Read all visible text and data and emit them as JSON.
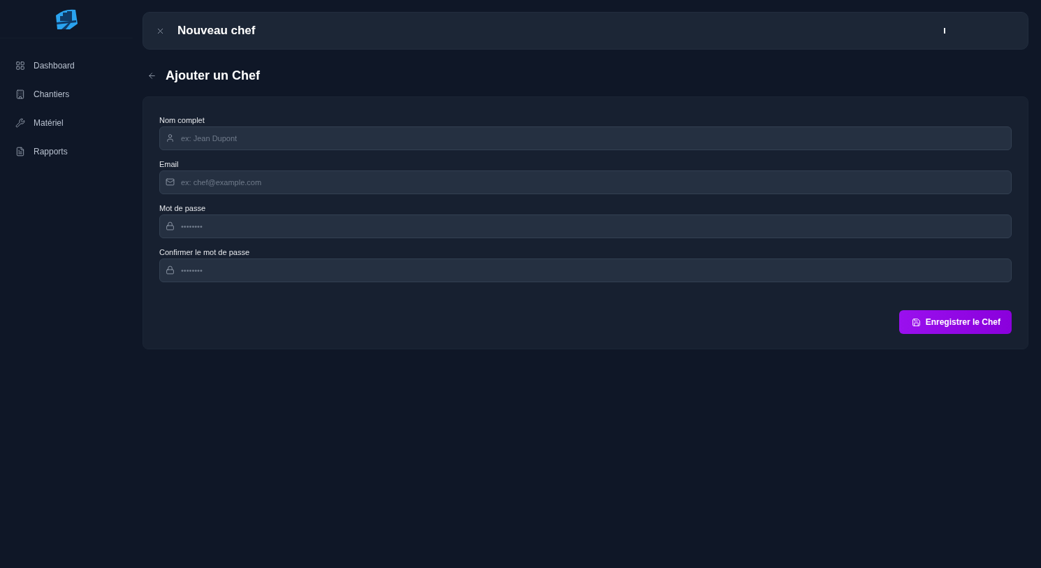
{
  "sidebar": {
    "items": [
      {
        "label": "Dashboard"
      },
      {
        "label": "Chantiers"
      },
      {
        "label": "Matériel"
      },
      {
        "label": "Rapports"
      }
    ]
  },
  "header": {
    "title": "Nouveau chef"
  },
  "page": {
    "title": "Ajouter un Chef"
  },
  "form": {
    "fields": [
      {
        "label": "Nom complet",
        "placeholder": "ex: Jean Dupont",
        "kind": "text"
      },
      {
        "label": "Email",
        "placeholder": "ex: chef@example.com",
        "kind": "email"
      },
      {
        "label": "Mot de passe",
        "placeholder": "••••••••",
        "kind": "password"
      },
      {
        "label": "Confirmer le mot de passe",
        "placeholder": "••••••••",
        "kind": "password"
      }
    ],
    "submit": "Enregistrer le Chef"
  }
}
